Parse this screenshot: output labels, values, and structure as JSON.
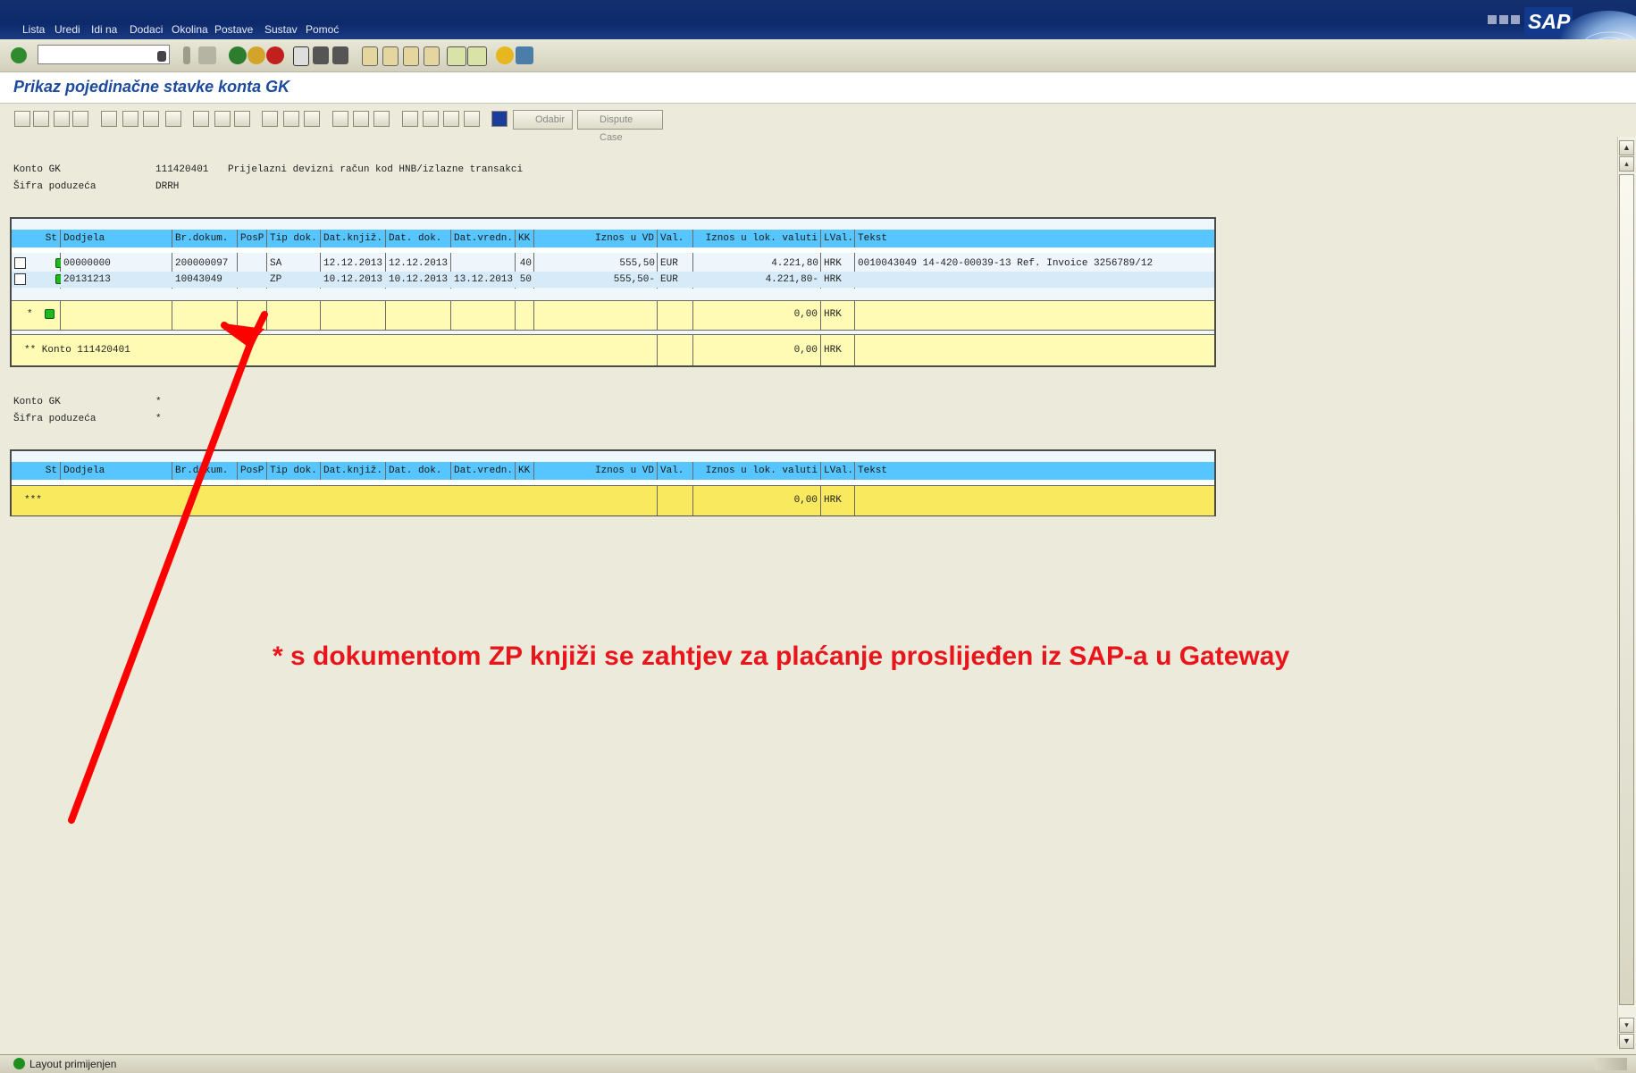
{
  "menu": {
    "items": [
      "Lista",
      "Uredi",
      "Idi na",
      "Dodaci",
      "Okolina",
      "Postave",
      "Sustav",
      "Pomoć"
    ]
  },
  "title": "Prikaz pojedinačne stavke konta GK",
  "toolbar": {
    "odabir_label": "Odabir",
    "dispute_label": "Dispute Case"
  },
  "logo": "SAP",
  "header1": {
    "konto_label": "Konto GK",
    "konto_value": "111420401",
    "konto_desc": "Prijelazni devizni račun kod HNB/izlazne transakci",
    "sifra_label": "Šifra poduzeća",
    "sifra_value": "DRRH"
  },
  "columns": [
    "St",
    "Dodjela",
    "Br.dokum.",
    "PosP",
    "Tip dok.",
    "Dat.knjiž.",
    "Dat. dok.",
    "Dat.vredn.",
    "KK",
    "Iznos u VD",
    "Val.",
    "Iznos u lok. valuti",
    "LVal.",
    "Tekst"
  ],
  "rows": [
    {
      "dodjela": "00000000",
      "brdok": "200000097",
      "tip": "SA",
      "datknj": "12.12.2013",
      "datdok": "12.12.2013",
      "datvr": "",
      "kk": "40",
      "iznosvd": "555,50",
      "val": "EUR",
      "iznoslok": "4.221,80",
      "lval": "HRK",
      "tekst": "0010043049 14-420-00039-13 Ref. Invoice 3256789/12"
    },
    {
      "dodjela": "20131213",
      "brdok": "10043049",
      "tip": "ZP",
      "datknj": "10.12.2013",
      "datdok": "10.12.2013",
      "datvr": "13.12.2013",
      "kk": "50",
      "iznosvd": "555,50-",
      "val": "EUR",
      "iznoslok": "4.221,80-",
      "lval": "HRK",
      "tekst": ""
    }
  ],
  "subtotal": {
    "marker": "*",
    "amount": "0,00",
    "currency": "HRK"
  },
  "total": {
    "label": "** Konto 111420401",
    "amount": "0,00",
    "currency": "HRK"
  },
  "header2": {
    "konto_label": "Konto GK",
    "konto_value": "*",
    "sifra_label": "Šifra poduzeća",
    "sifra_value": "*"
  },
  "grandtotal": {
    "marker": "***",
    "amount": "0,00",
    "currency": "HRK"
  },
  "annotation": "* s dokumentom ZP knjiži se zahtjev za plaćanje proslijeđen iz SAP-a u Gateway",
  "status": "Layout primijenjen",
  "colors": {
    "menubar": "#15306e",
    "header_row": "#57c5ff",
    "total_row": "#fffbb5",
    "grandtotal_row": "#f8e95e",
    "annotation": "#e8161c",
    "title": "#1c4a9c"
  }
}
